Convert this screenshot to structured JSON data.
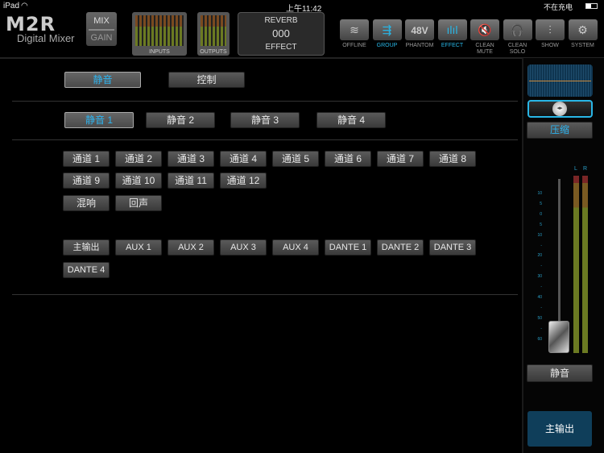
{
  "status_bar": {
    "device": "iPad",
    "time": "上午11:42",
    "charging": "不在充电"
  },
  "logo": {
    "brand": "M2R",
    "subtitle": "Digital Mixer"
  },
  "mix_gain": {
    "mix": "MIX",
    "gain": "GAIN"
  },
  "meters": {
    "inputs": "INPUTS",
    "outputs": "OUTPUTS"
  },
  "effect_display": {
    "type": "REVERB",
    "number": "000",
    "label": "EFFECT"
  },
  "toolbar": [
    {
      "label": "OFFLINE",
      "icon": "wifi-icon",
      "glyph": "≋",
      "active": false
    },
    {
      "label": "GROUP",
      "icon": "group-arrows-icon",
      "glyph": "⇶",
      "active": true
    },
    {
      "label": "PHANTOM",
      "icon": "48v-icon",
      "glyph": "48V",
      "active": false
    },
    {
      "label": "EFFECT",
      "icon": "effect-bars-icon",
      "glyph": "ılıl",
      "active": true
    },
    {
      "label": "CLEAN MUTE",
      "icon": "mute-speaker-icon",
      "glyph": "🔇",
      "active": false
    },
    {
      "label": "CLEAN SOLO",
      "icon": "headphones-icon",
      "glyph": "🎧",
      "active": false
    },
    {
      "label": "SHOW",
      "icon": "faders-icon",
      "glyph": "⫶",
      "active": false
    },
    {
      "label": "SYSTEM",
      "icon": "gear-icon",
      "glyph": "⚙",
      "active": false
    }
  ],
  "mode_tabs": [
    "静音",
    "控制"
  ],
  "group_tabs": [
    "静音 1",
    "静音 2",
    "静音 3",
    "静音 4"
  ],
  "channels": [
    "通道 1",
    "通道 2",
    "通道 3",
    "通道 4",
    "通道 5",
    "通道 6",
    "通道 7",
    "通道 8",
    "通道 9",
    "通道 10",
    "通道 11",
    "通道 12"
  ],
  "fx_returns": [
    "混响",
    "回声"
  ],
  "outputs": [
    "主输出",
    "AUX 1",
    "AUX 2",
    "AUX 3",
    "AUX 4",
    "DANTE 1",
    "DANTE 2",
    "DANTE 3",
    "DANTE 4"
  ],
  "right_panel": {
    "compress": "压缩",
    "meter_l": "L",
    "meter_r": "R",
    "scale": [
      "10",
      "5",
      "0",
      "5",
      "10",
      "-",
      "20",
      "-",
      "30",
      "-",
      "40",
      "-",
      "50",
      "-",
      "60"
    ],
    "mute": "静音",
    "main_out": "主输出"
  }
}
